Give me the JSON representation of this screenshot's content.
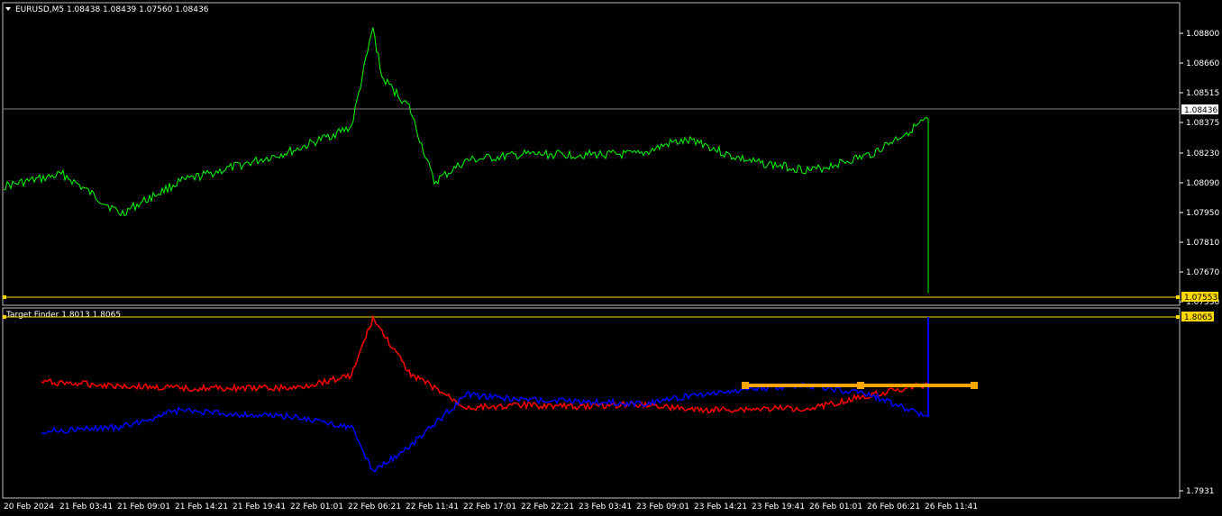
{
  "window": {
    "symbol_header": "EURUSD,M5  1.08438 1.08439 1.07560 1.08436",
    "indicator_header": "Target Finder 1.8013 1.8065"
  },
  "price_axis": {
    "ticks": [
      "1.08800",
      "1.08660",
      "1.08515",
      "1.08375",
      "1.08230",
      "1.08090",
      "1.07950",
      "1.07810",
      "1.07670",
      "1.07530"
    ],
    "current_price_label": "1.08436",
    "yellow_line_label": "1.07553"
  },
  "indicator_axis": {
    "top_label": "1.8065",
    "bottom_tick": "1.7931"
  },
  "time_axis": {
    "labels": [
      "20 Feb 2024",
      "21 Feb 03:41",
      "21 Feb 09:01",
      "21 Feb 14:21",
      "21 Feb 19:41",
      "22 Feb 01:01",
      "22 Feb 06:21",
      "22 Feb 11:41",
      "22 Feb 17:01",
      "22 Feb 22:21",
      "23 Feb 03:41",
      "23 Feb 09:01",
      "23 Feb 14:21",
      "23 Feb 19:41",
      "26 Feb 01:01",
      "26 Feb 06:21",
      "26 Feb 11:41"
    ]
  },
  "colors": {
    "background": "#000000",
    "price_line": "#00ff00",
    "indicator_red": "#ff0000",
    "indicator_blue": "#0000ff",
    "target_line": "#ffa500",
    "yellow_lines": "#ffd700",
    "grid_text": "#ffffff"
  },
  "chart_data": [
    {
      "type": "line",
      "title": "EURUSD,M5",
      "series": [
        {
          "name": "EURUSD",
          "x": [
            "20 Feb 2024",
            "21 Feb 03:41",
            "21 Feb 09:01",
            "21 Feb 14:21",
            "21 Feb 19:41",
            "22 Feb 01:01",
            "22 Feb 06:21",
            "22 Feb 08:20",
            "22 Feb 09:10",
            "22 Feb 11:41",
            "22 Feb 14:00",
            "22 Feb 17:01",
            "22 Feb 22:21",
            "23 Feb 03:41",
            "23 Feb 09:01",
            "23 Feb 12:00",
            "23 Feb 14:21",
            "23 Feb 17:00",
            "23 Feb 19:41",
            "26 Feb 01:01",
            "26 Feb 06:21",
            "26 Feb 11:41"
          ],
          "values": [
            1.081,
            1.0816,
            1.0796,
            1.0812,
            1.082,
            1.0828,
            1.084,
            1.089,
            1.0865,
            1.085,
            1.0812,
            1.0823,
            1.0826,
            1.0826,
            1.0826,
            1.0832,
            1.0833,
            1.0826,
            1.0822,
            1.0818,
            1.0826,
            1.0844
          ]
        }
      ],
      "ylim": [
        1.0753,
        1.0895
      ],
      "annotations": {
        "current_price": 1.08436,
        "bar_low": 1.0756,
        "horizontal_line": 1.07553
      }
    },
    {
      "type": "line",
      "title": "Target Finder",
      "series": [
        {
          "name": "red",
          "x": [
            "21 Feb 03:41",
            "21 Feb 09:01",
            "21 Feb 14:21",
            "21 Feb 19:41",
            "22 Feb 01:01",
            "22 Feb 06:21",
            "22 Feb 08:20",
            "22 Feb 11:41",
            "22 Feb 17:01",
            "22 Feb 22:21",
            "23 Feb 03:41",
            "23 Feb 09:01",
            "23 Feb 14:21",
            "23 Feb 19:41",
            "26 Feb 01:01",
            "26 Feb 06:21",
            "26 Feb 11:41"
          ],
          "values": [
            1.8015,
            1.8012,
            1.801,
            1.801,
            1.801,
            1.802,
            1.8064,
            1.8022,
            1.7995,
            1.7997,
            1.7996,
            1.7998,
            1.7993,
            1.7994,
            1.7995,
            1.8005,
            1.8013
          ]
        },
        {
          "name": "blue",
          "x": [
            "21 Feb 03:41",
            "21 Feb 09:01",
            "21 Feb 14:21",
            "21 Feb 19:41",
            "22 Feb 01:01",
            "22 Feb 06:21",
            "22 Feb 08:20",
            "22 Feb 11:41",
            "22 Feb 17:01",
            "22 Feb 22:21",
            "23 Feb 03:41",
            "23 Feb 09:01",
            "23 Feb 14:21",
            "23 Feb 19:41",
            "26 Feb 01:01",
            "26 Feb 06:21",
            "26 Feb 11:41"
          ],
          "values": [
            1.7977,
            1.798,
            1.7993,
            1.799,
            1.7988,
            1.798,
            1.7946,
            1.7965,
            1.8005,
            1.8001,
            1.8,
            1.7998,
            1.8005,
            1.801,
            1.8012,
            1.8005,
            1.7988
          ]
        }
      ],
      "ylim": [
        1.7931,
        1.8065
      ],
      "annotations": {
        "target_level": 1.8013,
        "top_level": 1.8065
      }
    }
  ]
}
